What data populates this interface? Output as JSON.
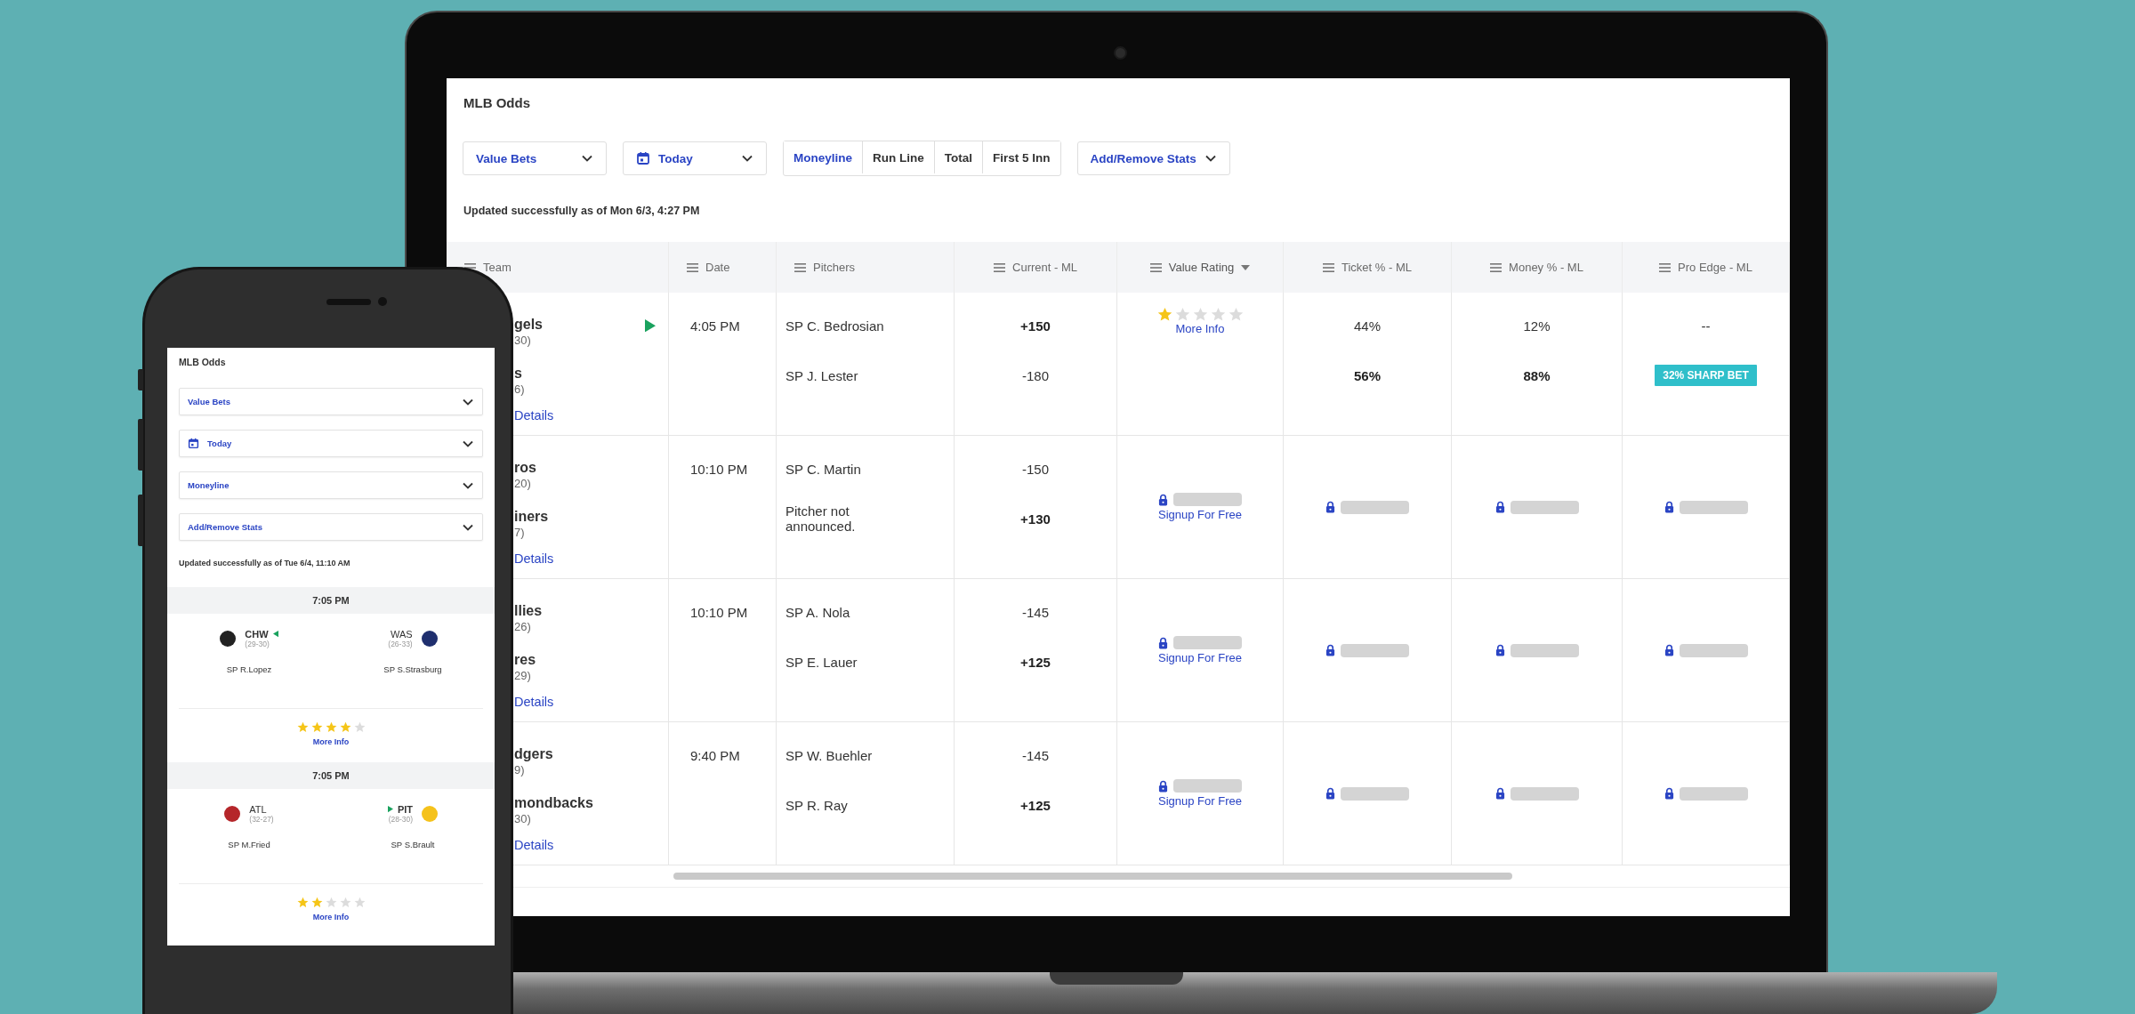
{
  "laptop": {
    "title": "MLB Odds",
    "filters": [
      {
        "kind": "select",
        "label": "Value Bets"
      },
      {
        "kind": "date",
        "label": "Today"
      }
    ],
    "bet_types": [
      {
        "label": "Moneyline",
        "selected": true
      },
      {
        "label": "Run Line",
        "selected": false
      },
      {
        "label": "Total",
        "selected": false
      },
      {
        "label": "First 5 Inn",
        "selected": false
      }
    ],
    "stats_menu": "Add/Remove Stats",
    "updated": "Updated successfully as of Mon 6/3, 4:27 PM",
    "table": {
      "columns": [
        {
          "label": "Team",
          "sorted": false
        },
        {
          "label": "Date",
          "sorted": false
        },
        {
          "label": "Pitchers",
          "sorted": false
        },
        {
          "label": "Current - ML",
          "sorted": false
        },
        {
          "label": "Value Rating",
          "sorted": true
        },
        {
          "label": "Ticket % - ML",
          "sorted": false
        },
        {
          "label": "Money % - ML",
          "sorted": false
        },
        {
          "label": "Pro Edge - ML",
          "sorted": false
        }
      ],
      "rows": [
        {
          "teams": [
            {
              "name": "gels",
              "record": "30)"
            },
            {
              "name": "s",
              "record": "6)"
            }
          ],
          "pick": true,
          "details": "Details",
          "time": "4:05 PM",
          "pitchers": [
            "SP C. Bedrosian",
            "SP J. Lester"
          ],
          "odds": [
            {
              "text": "+150",
              "bold": true
            },
            {
              "text": "-180",
              "bold": false
            }
          ],
          "locked": false,
          "stars": 1,
          "more_info": "More Info",
          "tickets": [
            {
              "text": "44%",
              "bold": false
            },
            {
              "text": "56%",
              "bold": true
            }
          ],
          "money": [
            {
              "text": "12%",
              "bold": false
            },
            {
              "text": "88%",
              "bold": true
            }
          ],
          "pro_edge": "--",
          "sharp_badge": "32% SHARP BET"
        },
        {
          "teams": [
            {
              "name": "ros",
              "record": "20)"
            },
            {
              "name": "iners",
              "record": "7)"
            }
          ],
          "pick": false,
          "details": "Details",
          "time": "10:10 PM",
          "pitchers": [
            "SP C. Martin",
            "Pitcher not announced."
          ],
          "odds": [
            {
              "text": "-150",
              "bold": false
            },
            {
              "text": "+130",
              "bold": true
            }
          ],
          "locked": true,
          "signup": "Signup For Free"
        },
        {
          "teams": [
            {
              "name": "llies",
              "record": "26)"
            },
            {
              "name": "res",
              "record": "29)"
            }
          ],
          "pick": false,
          "details": "Details",
          "time": "10:10 PM",
          "pitchers": [
            "SP A. Nola",
            "SP E. Lauer"
          ],
          "odds": [
            {
              "text": "-145",
              "bold": false
            },
            {
              "text": "+125",
              "bold": true
            }
          ],
          "locked": true,
          "signup": "Signup For Free"
        },
        {
          "teams": [
            {
              "name": "dgers",
              "record": "9)"
            },
            {
              "name": "mondbacks",
              "record": "30)"
            }
          ],
          "pick": false,
          "details": "Details",
          "time": "9:40 PM",
          "pitchers": [
            "SP W. Buehler",
            "SP R. Ray"
          ],
          "odds": [
            {
              "text": "-145",
              "bold": false
            },
            {
              "text": "+125",
              "bold": true
            }
          ],
          "locked": true,
          "signup": "Signup For Free"
        }
      ]
    }
  },
  "phone": {
    "title": "MLB Odds",
    "filters": [
      {
        "kind": "select",
        "label": "Value Bets"
      },
      {
        "kind": "date",
        "label": "Today"
      },
      {
        "kind": "select",
        "label": "Moneyline"
      },
      {
        "kind": "select",
        "label": "Add/Remove Stats"
      }
    ],
    "updated": "Updated successfully as of Tue 6/4, 11:10 AM",
    "games": [
      {
        "time": "7:05 PM",
        "teams": [
          {
            "abbr": "CHW",
            "record": "(29-30)",
            "pitcher": "SP R.Lopez",
            "pick": true,
            "color": "#222222"
          },
          {
            "abbr": "WAS",
            "record": "(26-33)",
            "pitcher": "SP S.Strasburg",
            "pick": false,
            "color": "#1f2f6e"
          }
        ],
        "stars": 4,
        "more_info": "More Info"
      },
      {
        "time": "7:05 PM",
        "teams": [
          {
            "abbr": "ATL",
            "record": "(32-27)",
            "pitcher": "SP M.Fried",
            "pick": false,
            "color": "#b5262a"
          },
          {
            "abbr": "PIT",
            "record": "(28-30)",
            "pitcher": "SP S.Brault",
            "pick": true,
            "color": "#f5c21b"
          }
        ],
        "stars": 2,
        "more_info": "More Info"
      }
    ]
  }
}
